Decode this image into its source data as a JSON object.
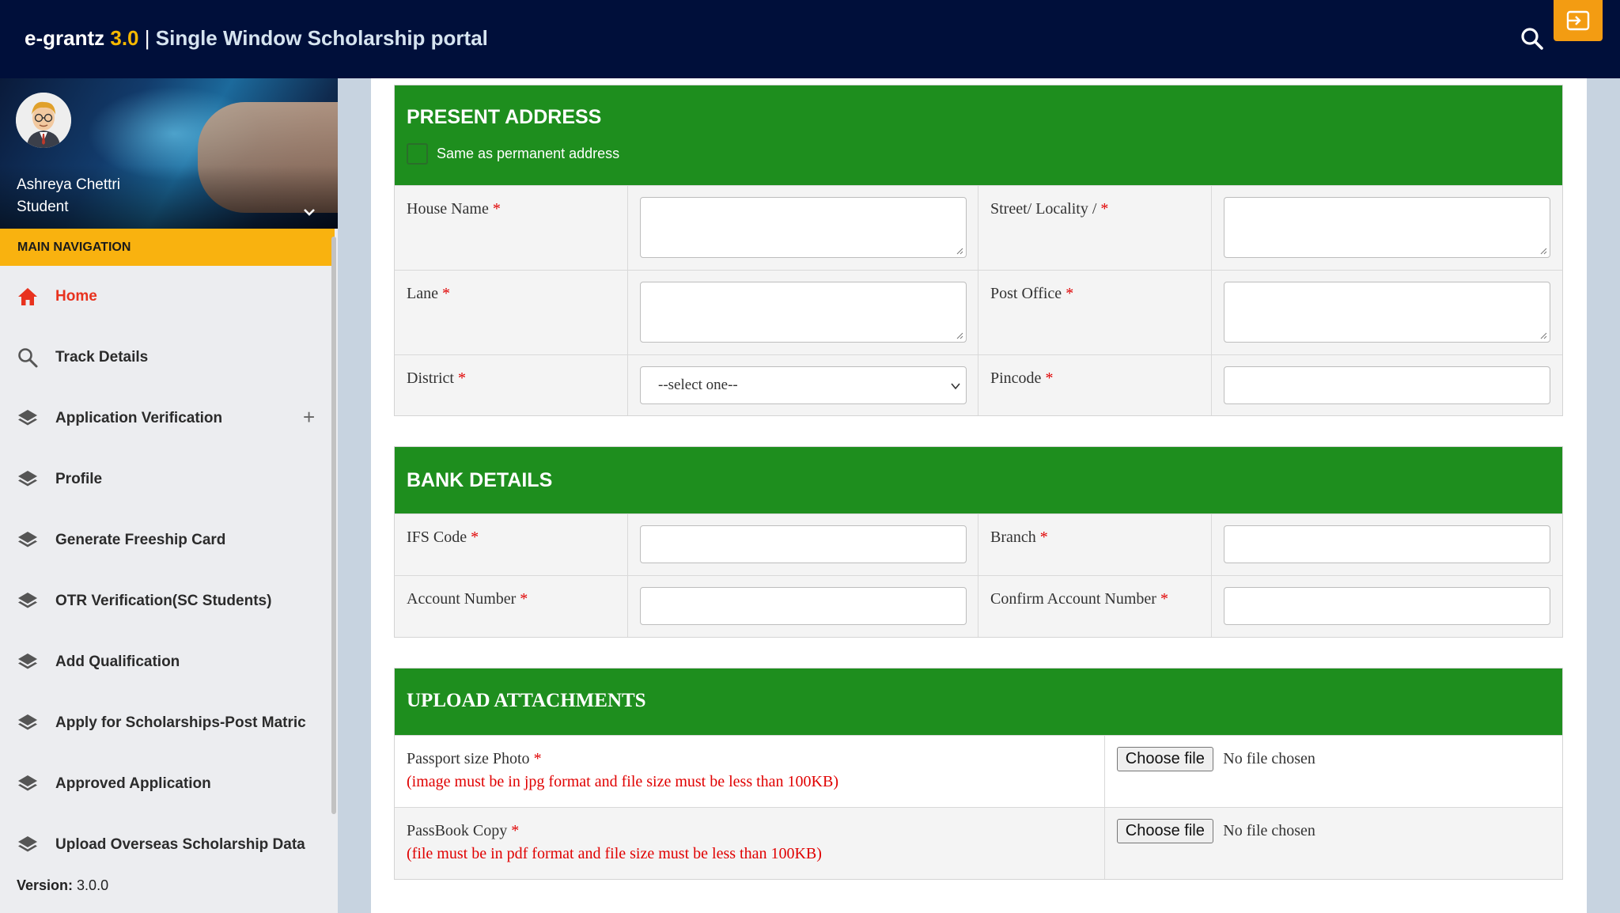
{
  "header": {
    "brand_name": "e-grantz",
    "brand_version": "3.0",
    "separator": "|",
    "portal_title": "Single Window Scholarship portal",
    "search_icon": "search-icon",
    "logout_icon": "sign-out-icon"
  },
  "user": {
    "name": "Ashreya Chettri",
    "role": "Student"
  },
  "sidebar": {
    "header": "MAIN NAVIGATION",
    "items": [
      {
        "label": "Home",
        "icon": "home-icon",
        "active": true
      },
      {
        "label": "Track Details",
        "icon": "search-icon"
      },
      {
        "label": "Application Verification",
        "icon": "layers-icon",
        "expandable": true
      },
      {
        "label": "Profile",
        "icon": "layers-icon"
      },
      {
        "label": "Generate Freeship Card",
        "icon": "layers-icon"
      },
      {
        "label": "OTR Verification(SC Students)",
        "icon": "layers-icon"
      },
      {
        "label": "Add Qualification",
        "icon": "layers-icon"
      },
      {
        "label": "Apply for Scholarships-Post Matric",
        "icon": "layers-icon"
      },
      {
        "label": "Approved Application",
        "icon": "layers-icon"
      },
      {
        "label": "Upload Overseas Scholarship Data",
        "icon": "layers-icon"
      }
    ],
    "expand_symbol": "+",
    "version_label": "Version:",
    "version_value": "3.0.0"
  },
  "present_address": {
    "title": "PRESENT ADDRESS",
    "same_as_label": "Same as permanent address",
    "house_name": "House Name",
    "street": "Street/ Locality /",
    "lane": "Lane",
    "post_office": "Post Office",
    "district": "District",
    "district_value": "--select one--",
    "pincode": "Pincode"
  },
  "bank_details": {
    "title": "BANK DETAILS",
    "ifs_code": "IFS Code",
    "branch": "Branch",
    "account_number": "Account Number",
    "confirm_account_number": "Confirm Account Number"
  },
  "attachments": {
    "title": "UPLOAD ATTACHMENTS",
    "photo_label": "Passport size Photo",
    "photo_hint": "(image must be in jpg format and file size must be less than 100KB)",
    "passbook_label": "PassBook Copy",
    "passbook_hint": "(file must be in pdf format and file size must be less than 100KB)",
    "choose_file": "Choose file",
    "no_file": "No file chosen"
  },
  "required_mark": "*",
  "colors": {
    "topbar": "#000f3a",
    "accent_yellow": "#f9b20f",
    "section_green": "#1e8e1e",
    "active_red": "#e8321e",
    "required_red": "#e00000"
  }
}
